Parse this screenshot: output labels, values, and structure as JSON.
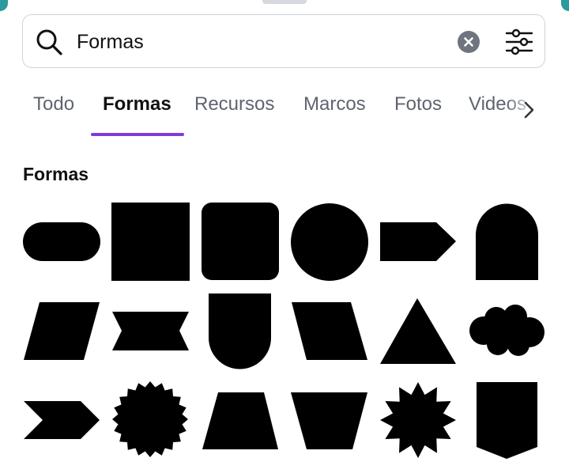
{
  "search": {
    "value": "Formas",
    "icon": "search-icon",
    "clear_icon": "clear-icon",
    "filter_icon": "filter-settings-icon"
  },
  "tabs": [
    {
      "label": "Todo",
      "active": false
    },
    {
      "label": "Formas",
      "active": true
    },
    {
      "label": "Recursos",
      "active": false
    },
    {
      "label": "Marcos",
      "active": false
    },
    {
      "label": "Fotos",
      "active": false
    },
    {
      "label": "Videos",
      "active": false
    }
  ],
  "tab_next_icon": "chevron-right-icon",
  "section": {
    "title": "Formas"
  },
  "shapes": [
    "rounded-pill-shape",
    "square-shape",
    "rounded-square-shape",
    "circle-shape",
    "arrow-pentagon-shape",
    "arch-shape",
    "parallelogram-shape",
    "ribbon-banner-shape",
    "u-shape",
    "reverse-parallelogram-shape",
    "triangle-shape",
    "cloud-shape",
    "chevron-shape",
    "badge-starburst-shape",
    "trapezoid-shape",
    "inverted-trapezoid-shape",
    "star-burst-shape",
    "pennant-shape"
  ],
  "colors": {
    "accent": "#7d3cdb",
    "shape_fill": "#000000",
    "tab_inactive": "#5e6470",
    "border": "#cfd3d9",
    "teal_edge": "#2a9a9c"
  }
}
